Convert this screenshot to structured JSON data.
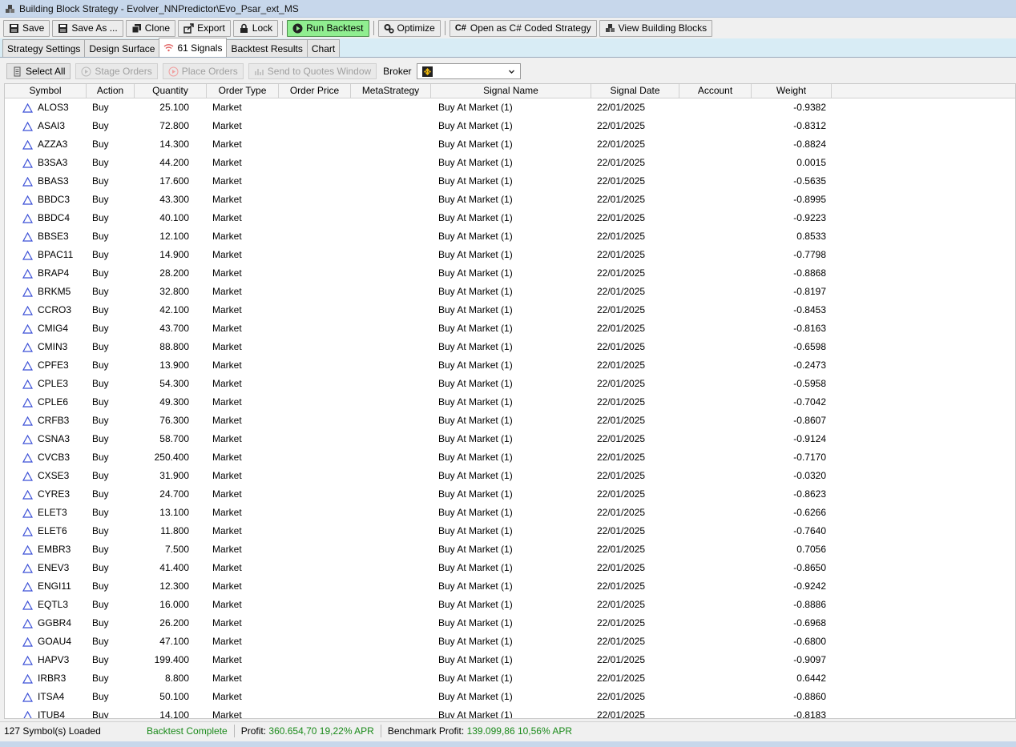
{
  "window": {
    "title": "Building Block Strategy - Evolver_NNPredictor\\Evo_Psar_ext_MS"
  },
  "toolbar": {
    "save": "Save",
    "save_as": "Save As ...",
    "clone": "Clone",
    "export": "Export",
    "lock": "Lock",
    "run_backtest": "Run Backtest",
    "optimize": "Optimize",
    "open_csharp": "Open as C# Coded Strategy",
    "view_blocks": "View Building Blocks"
  },
  "tabs": [
    "Strategy Settings",
    "Design Surface",
    "61 Signals",
    "Backtest Results",
    "Chart"
  ],
  "subbar": {
    "select_all": "Select All",
    "stage_orders": "Stage Orders",
    "place_orders": "Place Orders",
    "send_quotes": "Send to Quotes Window",
    "broker_label": "Broker"
  },
  "columns": [
    "Symbol",
    "Action",
    "Quantity",
    "Order Type",
    "Order Price",
    "MetaStrategy",
    "Signal Name",
    "Signal Date",
    "Account",
    "Weight"
  ],
  "rows": [
    [
      "ALOS3",
      "Buy",
      "25.100",
      "Market",
      "",
      "",
      "Buy At Market (1)",
      "22/01/2025",
      "",
      "-0.9382"
    ],
    [
      "ASAI3",
      "Buy",
      "72.800",
      "Market",
      "",
      "",
      "Buy At Market (1)",
      "22/01/2025",
      "",
      "-0.8312"
    ],
    [
      "AZZA3",
      "Buy",
      "14.300",
      "Market",
      "",
      "",
      "Buy At Market (1)",
      "22/01/2025",
      "",
      "-0.8824"
    ],
    [
      "B3SA3",
      "Buy",
      "44.200",
      "Market",
      "",
      "",
      "Buy At Market (1)",
      "22/01/2025",
      "",
      "0.0015"
    ],
    [
      "BBAS3",
      "Buy",
      "17.600",
      "Market",
      "",
      "",
      "Buy At Market (1)",
      "22/01/2025",
      "",
      "-0.5635"
    ],
    [
      "BBDC3",
      "Buy",
      "43.300",
      "Market",
      "",
      "",
      "Buy At Market (1)",
      "22/01/2025",
      "",
      "-0.8995"
    ],
    [
      "BBDC4",
      "Buy",
      "40.100",
      "Market",
      "",
      "",
      "Buy At Market (1)",
      "22/01/2025",
      "",
      "-0.9223"
    ],
    [
      "BBSE3",
      "Buy",
      "12.100",
      "Market",
      "",
      "",
      "Buy At Market (1)",
      "22/01/2025",
      "",
      "0.8533"
    ],
    [
      "BPAC11",
      "Buy",
      "14.900",
      "Market",
      "",
      "",
      "Buy At Market (1)",
      "22/01/2025",
      "",
      "-0.7798"
    ],
    [
      "BRAP4",
      "Buy",
      "28.200",
      "Market",
      "",
      "",
      "Buy At Market (1)",
      "22/01/2025",
      "",
      "-0.8868"
    ],
    [
      "BRKM5",
      "Buy",
      "32.800",
      "Market",
      "",
      "",
      "Buy At Market (1)",
      "22/01/2025",
      "",
      "-0.8197"
    ],
    [
      "CCRO3",
      "Buy",
      "42.100",
      "Market",
      "",
      "",
      "Buy At Market (1)",
      "22/01/2025",
      "",
      "-0.8453"
    ],
    [
      "CMIG4",
      "Buy",
      "43.700",
      "Market",
      "",
      "",
      "Buy At Market (1)",
      "22/01/2025",
      "",
      "-0.8163"
    ],
    [
      "CMIN3",
      "Buy",
      "88.800",
      "Market",
      "",
      "",
      "Buy At Market (1)",
      "22/01/2025",
      "",
      "-0.6598"
    ],
    [
      "CPFE3",
      "Buy",
      "13.900",
      "Market",
      "",
      "",
      "Buy At Market (1)",
      "22/01/2025",
      "",
      "-0.2473"
    ],
    [
      "CPLE3",
      "Buy",
      "54.300",
      "Market",
      "",
      "",
      "Buy At Market (1)",
      "22/01/2025",
      "",
      "-0.5958"
    ],
    [
      "CPLE6",
      "Buy",
      "49.300",
      "Market",
      "",
      "",
      "Buy At Market (1)",
      "22/01/2025",
      "",
      "-0.7042"
    ],
    [
      "CRFB3",
      "Buy",
      "76.300",
      "Market",
      "",
      "",
      "Buy At Market (1)",
      "22/01/2025",
      "",
      "-0.8607"
    ],
    [
      "CSNA3",
      "Buy",
      "58.700",
      "Market",
      "",
      "",
      "Buy At Market (1)",
      "22/01/2025",
      "",
      "-0.9124"
    ],
    [
      "CVCB3",
      "Buy",
      "250.400",
      "Market",
      "",
      "",
      "Buy At Market (1)",
      "22/01/2025",
      "",
      "-0.7170"
    ],
    [
      "CXSE3",
      "Buy",
      "31.900",
      "Market",
      "",
      "",
      "Buy At Market (1)",
      "22/01/2025",
      "",
      "-0.0320"
    ],
    [
      "CYRE3",
      "Buy",
      "24.700",
      "Market",
      "",
      "",
      "Buy At Market (1)",
      "22/01/2025",
      "",
      "-0.8623"
    ],
    [
      "ELET3",
      "Buy",
      "13.100",
      "Market",
      "",
      "",
      "Buy At Market (1)",
      "22/01/2025",
      "",
      "-0.6266"
    ],
    [
      "ELET6",
      "Buy",
      "11.800",
      "Market",
      "",
      "",
      "Buy At Market (1)",
      "22/01/2025",
      "",
      "-0.7640"
    ],
    [
      "EMBR3",
      "Buy",
      "7.500",
      "Market",
      "",
      "",
      "Buy At Market (1)",
      "22/01/2025",
      "",
      "0.7056"
    ],
    [
      "ENEV3",
      "Buy",
      "41.400",
      "Market",
      "",
      "",
      "Buy At Market (1)",
      "22/01/2025",
      "",
      "-0.8650"
    ],
    [
      "ENGI11",
      "Buy",
      "12.300",
      "Market",
      "",
      "",
      "Buy At Market (1)",
      "22/01/2025",
      "",
      "-0.9242"
    ],
    [
      "EQTL3",
      "Buy",
      "16.000",
      "Market",
      "",
      "",
      "Buy At Market (1)",
      "22/01/2025",
      "",
      "-0.8886"
    ],
    [
      "GGBR4",
      "Buy",
      "26.200",
      "Market",
      "",
      "",
      "Buy At Market (1)",
      "22/01/2025",
      "",
      "-0.6968"
    ],
    [
      "GOAU4",
      "Buy",
      "47.100",
      "Market",
      "",
      "",
      "Buy At Market (1)",
      "22/01/2025",
      "",
      "-0.6800"
    ],
    [
      "HAPV3",
      "Buy",
      "199.400",
      "Market",
      "",
      "",
      "Buy At Market (1)",
      "22/01/2025",
      "",
      "-0.9097"
    ],
    [
      "IRBR3",
      "Buy",
      "8.800",
      "Market",
      "",
      "",
      "Buy At Market (1)",
      "22/01/2025",
      "",
      "0.6442"
    ],
    [
      "ITSA4",
      "Buy",
      "50.100",
      "Market",
      "",
      "",
      "Buy At Market (1)",
      "22/01/2025",
      "",
      "-0.8860"
    ],
    [
      "ITUB4",
      "Buy",
      "14.100",
      "Market",
      "",
      "",
      "Buy At Market (1)",
      "22/01/2025",
      "",
      "-0.8183"
    ]
  ],
  "status": {
    "symbols_loaded": "127 Symbol(s) Loaded",
    "backtest": "Backtest Complete",
    "profit_label": "Profit:",
    "profit_value": "360.654,70 19,22% APR",
    "benchmark_label": "Benchmark Profit:",
    "benchmark_value": "139.099,86 10,56% APR"
  },
  "colors": {
    "run_button": "#90ee90",
    "status_green": "#1a8a1a",
    "tab_bar": "#d8ecf5",
    "symbol_icon": "#3b4fd6"
  }
}
